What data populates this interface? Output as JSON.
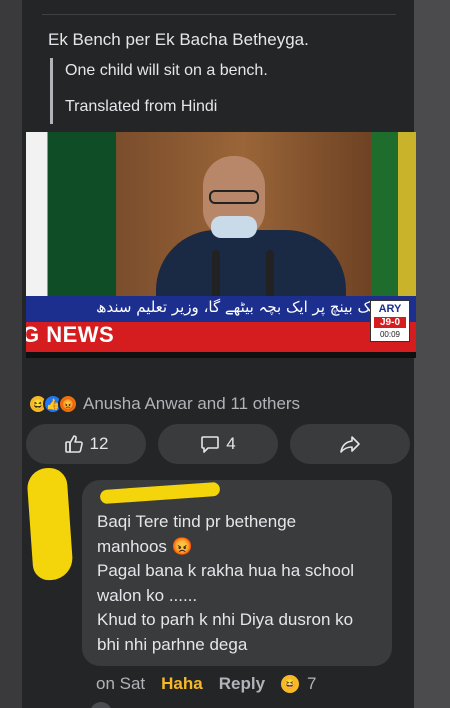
{
  "post": {
    "text": "Ek Bench per Ek Bacha Betheyga.",
    "translation": "One child will sit on a bench.",
    "translated_from": "Translated from Hindi"
  },
  "image": {
    "ticker_urdu": "ایک بینچ پر ایک بچہ بیٹھے گا، وزیر تعلیم سندھ",
    "ticker_english": "G NEWS",
    "logo": "ARY",
    "logo_number": "J9-0",
    "logo_time": "00:09"
  },
  "reactions": {
    "icons": [
      "haha-icon",
      "like-icon",
      "angry-icon"
    ],
    "names": "Anusha Anwar and 11 others"
  },
  "actions": {
    "like_count": "12",
    "comment_count": "4"
  },
  "comment": {
    "lines": [
      "Baqi Tere tind pr bethenge",
      "manhoos 😡",
      "Pagal bana k rakha hua ha school",
      "walon ko ......",
      "Khud to parh k nhi Diya dusron ko",
      "bhi nhi parhne dega"
    ],
    "time": "on Sat",
    "reaction_label": "Haha",
    "reply_label": "Reply",
    "reaction_count": "7"
  },
  "colors": {
    "background": "#242526",
    "button": "#3a3b3c",
    "text": "#e4e6eb",
    "muted": "#b0b3b8",
    "haha": "#f7b928",
    "highlight": "#f4d40a"
  }
}
